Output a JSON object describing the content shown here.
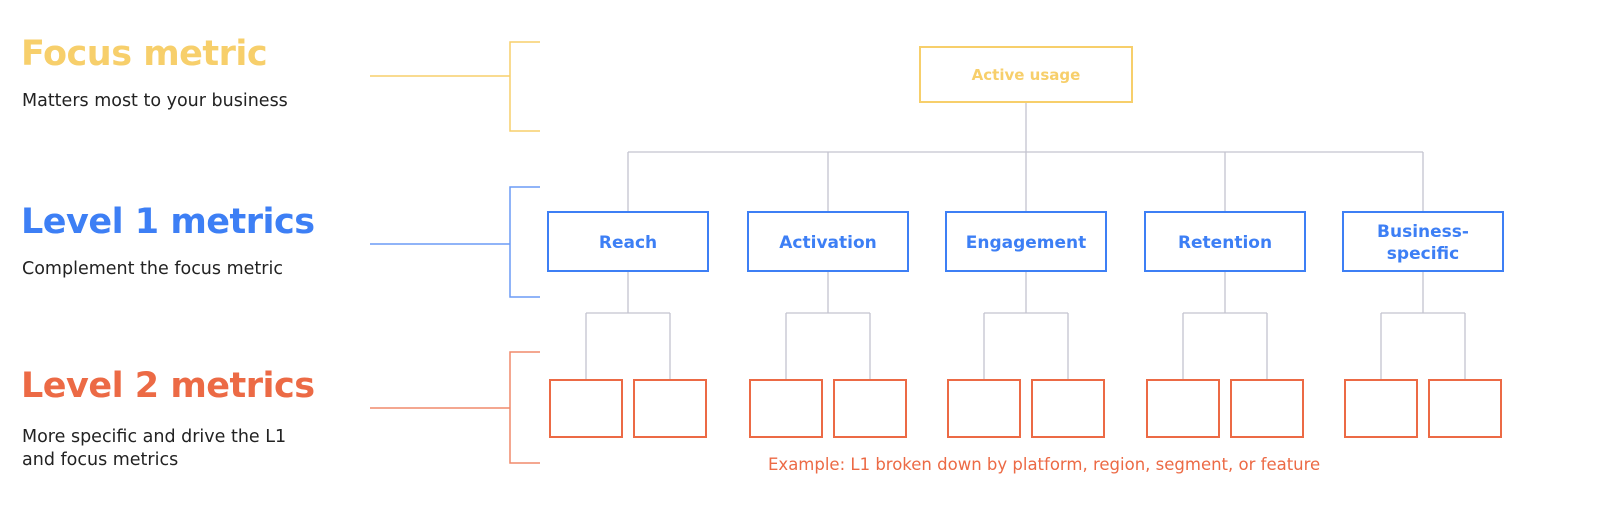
{
  "colors": {
    "focus": "#f7cf6b",
    "level1": "#3d7ff5",
    "level2": "#ec6a45",
    "connector": "#c3c3cf",
    "text": "#222222"
  },
  "levels": {
    "focus": {
      "title": "Focus metric",
      "subtitle": "Matters most to your business"
    },
    "level1": {
      "title": "Level 1 metrics",
      "subtitle": "Complement the focus metric"
    },
    "level2": {
      "title": "Level 2 metrics",
      "subtitle_line1": "More specific and drive the L1",
      "subtitle_line2": "and focus metrics"
    }
  },
  "tree": {
    "root": "Active usage",
    "l1": [
      {
        "label": "Reach"
      },
      {
        "label": "Activation"
      },
      {
        "label": "Engagement"
      },
      {
        "label": "Retention"
      },
      {
        "label_line1": "Business-",
        "label_line2": "specific"
      }
    ],
    "l2_boxes_per_l1": 2,
    "example": "Example: L1 broken down by platform, region, segment, or feature"
  }
}
